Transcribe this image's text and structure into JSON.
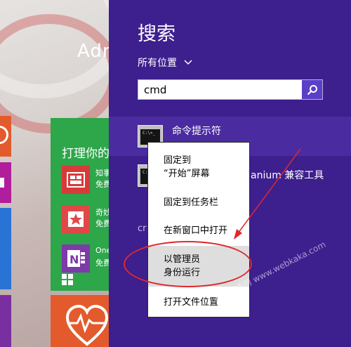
{
  "start_screen": {
    "user_name": "Adr",
    "tile_group_title": "打理你的",
    "apps": [
      {
        "name": "知事",
        "price": "免费"
      },
      {
        "name": "奇妙",
        "price": "免费"
      },
      {
        "name": "One",
        "price": "免费"
      }
    ]
  },
  "search": {
    "title": "搜索",
    "scope": "所有位置",
    "query": "cmd",
    "results": [
      {
        "label": "命令提示符"
      },
      {
        "label": "anium 兼容工具"
      }
    ],
    "section_partial": "cr"
  },
  "context_menu": {
    "pin_start": [
      "固定到",
      "“开始”屏幕"
    ],
    "pin_taskbar": "固定到任务栏",
    "new_window": "在新窗口中打开",
    "run_admin": [
      "以管理员",
      "身份运行"
    ],
    "open_location": "打开文件位置"
  },
  "cmd_icon_prompt": "C:\\>_",
  "watermark": "卡卡测速网 www.webkaka.com",
  "colors": {
    "charm_bg": "#3d1f8e",
    "selected_result": "#4a2ba0",
    "search_button": "#5b3fc8",
    "store_tile": "#2ea64a",
    "annotation_red": "#e0282c"
  }
}
